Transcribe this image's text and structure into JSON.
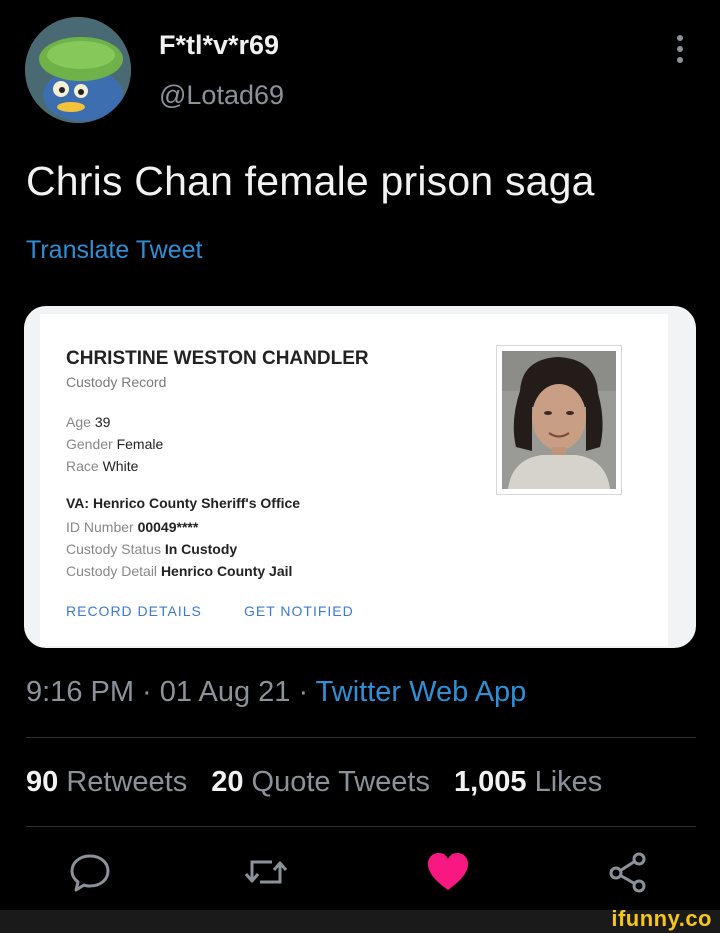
{
  "tweet": {
    "author_name": "F*tl*v*r69",
    "author_handle": "@Lotad69",
    "text": "Chris Chan female prison saga",
    "translate_label": "Translate Tweet",
    "time": "9:16 PM",
    "separator": " · ",
    "date": "01 Aug 21",
    "source_app": "Twitter Web App"
  },
  "record": {
    "name": "CHRISTINE WESTON CHANDLER",
    "subtitle": "Custody Record",
    "age_label": "Age",
    "age_value": "39",
    "gender_label": "Gender",
    "gender_value": "Female",
    "race_label": "Race",
    "race_value": "White",
    "agency": "VA: Henrico County Sheriff's Office",
    "id_label": "ID Number",
    "id_value": "00049****",
    "status_label": "Custody Status",
    "status_value": "In Custody",
    "detail_label": "Custody Detail",
    "detail_value": "Henrico County Jail",
    "record_details_link": "RECORD DETAILS",
    "get_notified_link": "GET NOTIFIED"
  },
  "stats": {
    "retweets_count": "90",
    "retweets_label": "Retweets",
    "quote_count": "20",
    "quote_label": "Quote Tweets",
    "likes_count": "1,005",
    "likes_label": "Likes"
  },
  "icons": {
    "more": "more-vertical-icon",
    "reply": "reply-icon",
    "retweet": "retweet-icon",
    "like": "heart-icon",
    "share": "share-icon"
  },
  "colors": {
    "background": "#000000",
    "link_blue": "#2f8fd6",
    "like_red": "#f91880",
    "muted": "#8b9299",
    "watermark": "#f5c518"
  },
  "watermark": "ifunny.co"
}
